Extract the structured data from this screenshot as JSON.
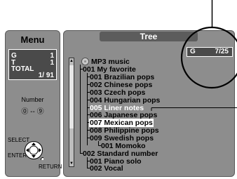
{
  "menu": {
    "title": "Menu",
    "counter": {
      "g_label": "G",
      "g_value": "1",
      "t_label": "T",
      "t_value": "1",
      "total_label": "TOTAL",
      "total_value": "1/  91"
    },
    "number_label": "Number",
    "number_range": "⓪ -- ⑨",
    "select_label": "SELECT",
    "enter_label": "ENTER",
    "return_label": "RETURN"
  },
  "tree": {
    "title": "Tree",
    "group_indicator": {
      "label": "G",
      "value": "7/25"
    },
    "root": "MP3 music",
    "items": [
      "001 My favorite",
      "001 Brazilian pops",
      "002 Chinese pops",
      "003 Czech pops",
      "004 Hungarian pops",
      "005 Liner notes",
      "006 Japanese pops",
      "007 Mexican pops",
      "008 Philippine pops",
      "009 Swedish pops",
      "001 Momoko",
      "002 Standard number",
      "001 Piano solo",
      "002 Vocal"
    ]
  }
}
